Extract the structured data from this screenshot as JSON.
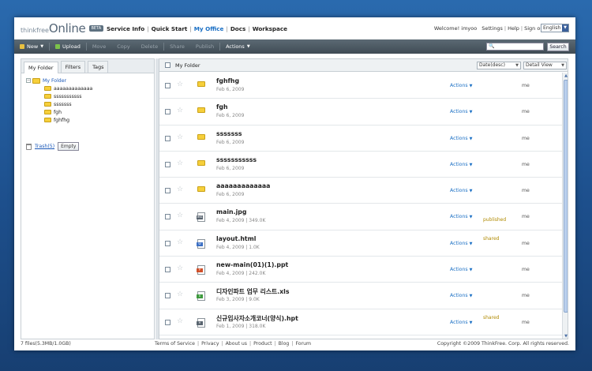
{
  "header": {
    "logo_small": "thinkfree",
    "logo_big": "Online",
    "logo_badge": "BETA",
    "nav": [
      {
        "label": "Service Info",
        "active": false
      },
      {
        "label": "Quick Start",
        "active": false
      },
      {
        "label": "My Office",
        "active": true
      },
      {
        "label": "Docs",
        "active": false
      },
      {
        "label": "Workspace",
        "active": false
      }
    ],
    "welcome": "Welcome! imyoo",
    "links": [
      "Settings",
      "Help",
      "Sign out"
    ],
    "language": "English"
  },
  "toolbar": {
    "new_label": "New",
    "upload_label": "Upload",
    "move_label": "Move",
    "copy_label": "Copy",
    "delete_label": "Delete",
    "share_label": "Share",
    "publish_label": "Publish",
    "actions_label": "Actions",
    "search_button": "Search"
  },
  "left": {
    "tabs": [
      "My Folder",
      "Filters",
      "Tags"
    ],
    "root_folder": "My Folder",
    "folders": [
      "aaaaaaaaaaaaa",
      "sssssssssss",
      "sssssss",
      "fgh",
      "fghfhg"
    ],
    "trash_label": "Trash(5)",
    "empty_label": "Empty"
  },
  "right": {
    "title": "My Folder",
    "sort_label": "Date(desc)",
    "view_label": "Detail View",
    "files": [
      {
        "name": "fghfhg",
        "meta": "Feb 6, 2009",
        "type": "folder",
        "actions": "Actions",
        "status": "",
        "owner": "me"
      },
      {
        "name": "fgh",
        "meta": "Feb 6, 2009",
        "type": "folder",
        "actions": "Actions",
        "status": "",
        "owner": "me"
      },
      {
        "name": "sssssss",
        "meta": "Feb 6, 2009",
        "type": "folder",
        "actions": "Actions",
        "status": "",
        "owner": "me"
      },
      {
        "name": "sssssssssss",
        "meta": "Feb 6, 2009",
        "type": "folder",
        "actions": "Actions",
        "status": "",
        "owner": "me"
      },
      {
        "name": "aaaaaaaaaaaaa",
        "meta": "Feb 6, 2009",
        "type": "folder",
        "actions": "Actions",
        "status": "",
        "owner": "me"
      },
      {
        "name": "main.jpg",
        "meta": "Feb 4, 2009 | 349.0K",
        "type": "image",
        "actions": "Actions",
        "status": "published",
        "owner": "me"
      },
      {
        "name": "layout.html",
        "meta": "Feb 4, 2009 | 1.0K",
        "type": "html",
        "actions": "Actions",
        "status": "shared",
        "owner": "me"
      },
      {
        "name": "new-main(01)(1).ppt",
        "meta": "Feb 4, 2009 | 242.0K",
        "type": "ppt",
        "actions": "Actions",
        "status": "",
        "owner": "me"
      },
      {
        "name": "디자인파트 업무 리스트.xls",
        "meta": "Feb 3, 2009 | 9.0K",
        "type": "xls",
        "actions": "Actions",
        "status": "",
        "owner": "me"
      },
      {
        "name": "신규입사자소개코너(양식).hpt",
        "meta": "Feb 1, 2009 | 318.0K",
        "type": "hwp",
        "actions": "Actions",
        "status": "shared",
        "owner": "me"
      }
    ]
  },
  "footer": {
    "storage": "7 files(5.3MB/1.0GB)",
    "links": [
      "Terms of Service",
      "Privacy",
      "About us",
      "Product",
      "Blog",
      "Forum"
    ],
    "copyright": "Copyright ©2009 ThinkFree. Corp. All rights reserved."
  },
  "colors": {
    "accent": "#1a6fc4",
    "toolbar": "#4b5862",
    "folder": "#f6cf3b",
    "status": "#b08a00"
  }
}
